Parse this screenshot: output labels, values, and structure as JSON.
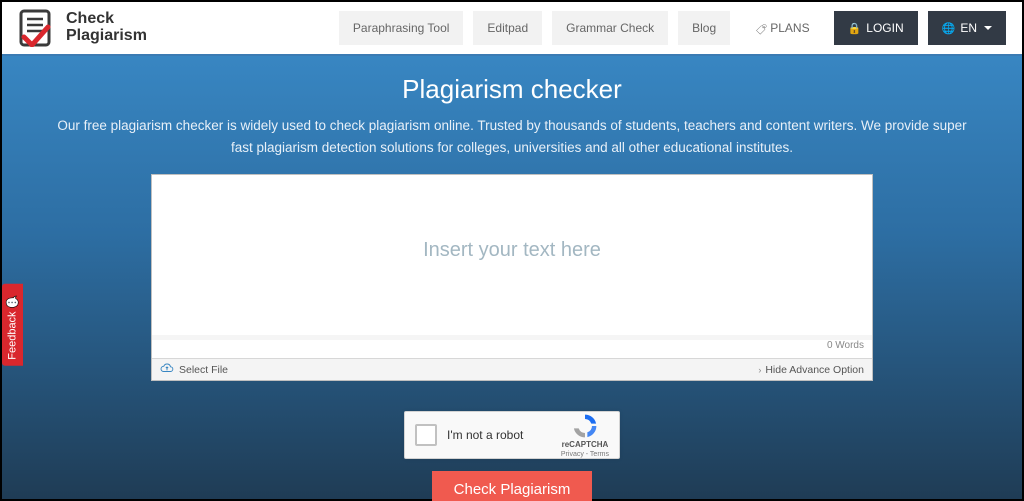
{
  "logo": {
    "line1": "Check",
    "line2": "Plagiarism"
  },
  "nav": {
    "paraphrasing": "Paraphrasing Tool",
    "editpad": "Editpad",
    "grammar": "Grammar Check",
    "blog": "Blog",
    "plans": "PLANS",
    "login": "LOGIN",
    "lang": "EN"
  },
  "hero": {
    "title": "Plagiarism checker",
    "subtitle": "Our free plagiarism checker is widely used to check plagiarism online. Trusted by thousands of students, teachers and content writers. We provide super fast plagiarism detection solutions for colleges, universities and all other educational institutes."
  },
  "editor": {
    "placeholder": "Insert your text here",
    "word_count": "0 Words",
    "select_file": "Select File",
    "hide_advance": "Hide Advance Option"
  },
  "recaptcha": {
    "label": "I'm not a robot",
    "brand": "reCAPTCHA",
    "terms": "Privacy - Terms"
  },
  "submit": "Check Plagiarism",
  "feedback": "Feedback"
}
